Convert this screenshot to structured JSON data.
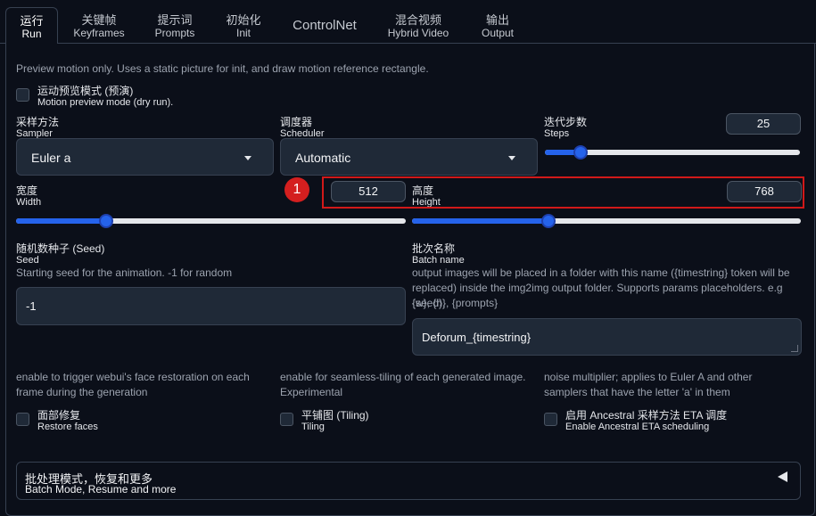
{
  "tabs": [
    {
      "cn": "运行",
      "en": "Run",
      "active": true
    },
    {
      "cn": "关键帧",
      "en": "Keyframes"
    },
    {
      "cn": "提示词",
      "en": "Prompts"
    },
    {
      "cn": "初始化",
      "en": "Init"
    },
    {
      "cn": "ControlNet",
      "en": ""
    },
    {
      "cn": "混合视频",
      "en": "Hybrid Video"
    },
    {
      "cn": "输出",
      "en": "Output"
    }
  ],
  "preview_info": "Preview motion only. Uses a static picture for init, and draw motion reference rectangle.",
  "motion_preview": {
    "cn": "运动预览模式 (预演)",
    "en": "Motion preview mode (dry run)."
  },
  "sampler": {
    "cn": "采样方法",
    "en": "Sampler",
    "value": "Euler a"
  },
  "scheduler": {
    "cn": "调度器",
    "en": "Scheduler",
    "value": "Automatic"
  },
  "steps": {
    "cn": "迭代步数",
    "en": "Steps",
    "value": "25",
    "level": 0.14
  },
  "width": {
    "cn": "宽度",
    "en": "Width",
    "value": "512",
    "level": 0.23
  },
  "height": {
    "cn": "高度",
    "en": "Height",
    "value": "768",
    "level": 0.35
  },
  "badge": "1",
  "seed": {
    "cn": "随机数种子 (Seed)",
    "en": "Seed",
    "info": "Starting seed for the animation. -1 for random",
    "value": "-1"
  },
  "batch_name": {
    "cn": "批次名称",
    "en": "Batch name",
    "info1": "output images will be placed in a folder with this name ({timestring} token will be",
    "info2": "replaced) inside the img2img output folder. Supports params placeholders. e.g {seed},",
    "info3": "{w}, {h}, {prompts}",
    "value": "Deforum_{timestring}"
  },
  "restore_faces": {
    "info1": "enable to trigger webui's face restoration on each",
    "info2": "frame during the generation",
    "cn": "面部修复",
    "en": "Restore faces"
  },
  "tiling": {
    "info1": "enable for seamless-tiling of each generated image.",
    "info2": "Experimental",
    "cn": "平铺图 (Tiling)",
    "en": "Tiling"
  },
  "ancestral": {
    "info1": "noise multiplier; applies to Euler A and other",
    "info2": "samplers that have the letter 'a' in them",
    "cn": "启用 Ancestral 采样方法 ETA 调度",
    "en": "Enable Ancestral ETA scheduling"
  },
  "batch_mode": {
    "cn": "批处理模式，恢复和更多",
    "en": "Batch Mode, Resume and more"
  },
  "colors": {
    "accent": "#2563eb",
    "highlight": "#d11919",
    "background": "#0b0f19"
  }
}
